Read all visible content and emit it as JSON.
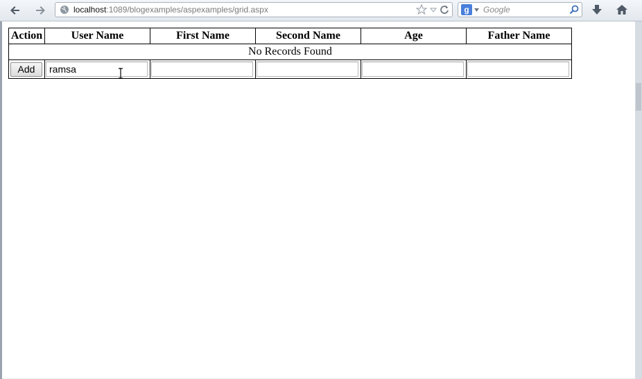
{
  "browser": {
    "url_host": "localhost",
    "url_path": ":1089/blogexamples/aspexamples/grid.aspx",
    "search_placeholder": "Google",
    "search_engine_letter": "g"
  },
  "grid": {
    "headers": [
      "Action",
      "User Name",
      "First Name",
      "Second Name",
      "Age",
      "Father Name"
    ],
    "empty_message": "No Records Found",
    "add_button": "Add",
    "inputs": {
      "user_name": "ramsa",
      "first_name": "",
      "second_name": "",
      "age": "",
      "father_name": ""
    }
  },
  "colors": {
    "toolbar": "#e9edf2",
    "page_bg": "#ffffff",
    "search_logo": "#4a7fdc"
  }
}
